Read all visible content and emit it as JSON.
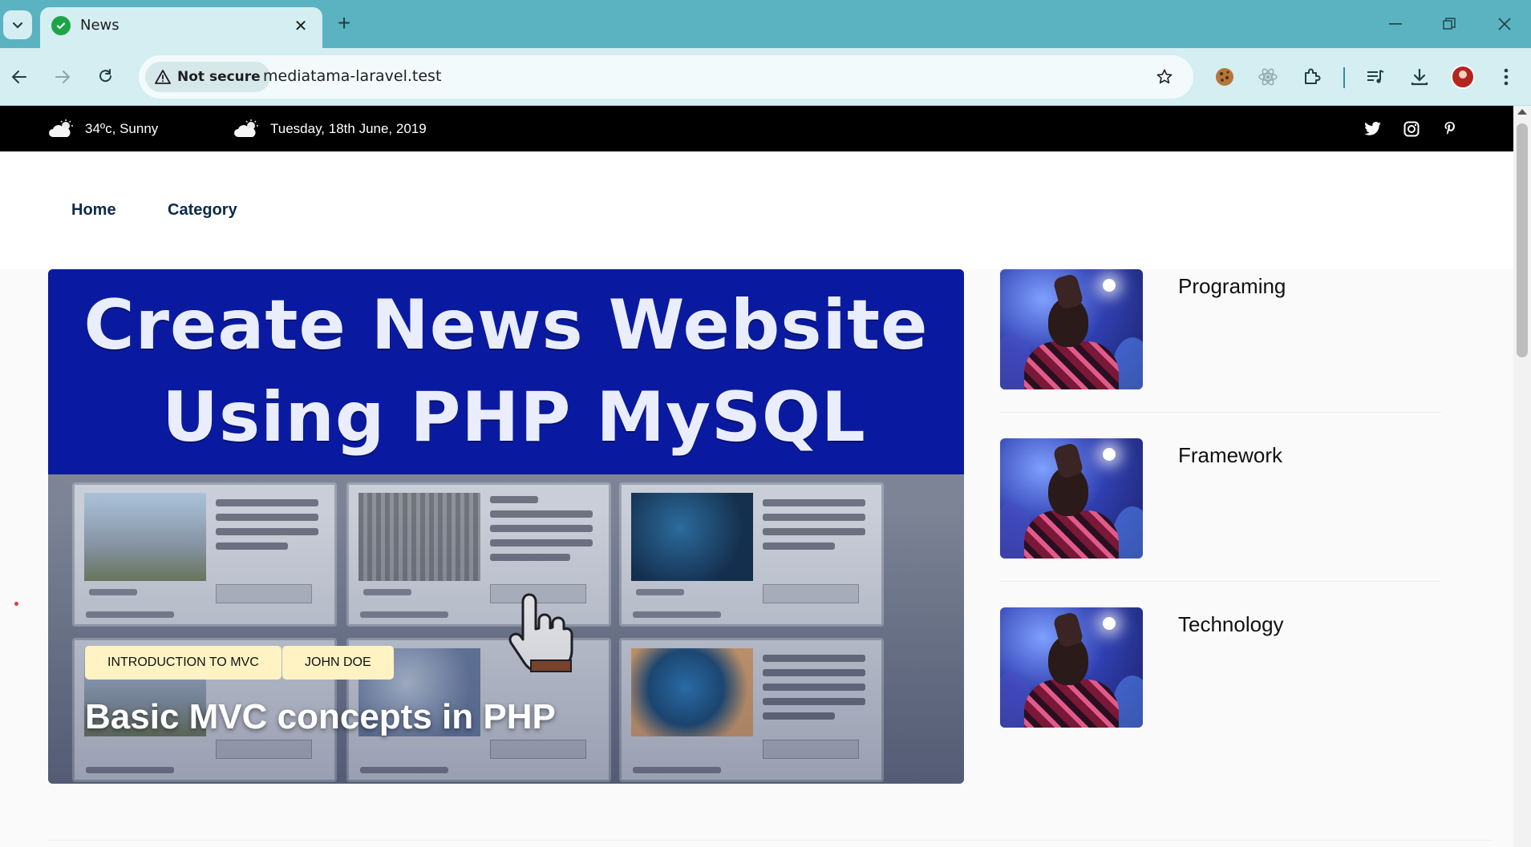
{
  "browser": {
    "tab_title": "News",
    "security_label": "Not secure",
    "url": "mediatama-laravel.test"
  },
  "topbar": {
    "weather_text": "34ºc, Sunny",
    "date_text": "Tuesday, 18th June, 2019",
    "social": [
      "twitter-icon",
      "instagram-icon",
      "pinterest-icon"
    ]
  },
  "nav": {
    "items": [
      "Home",
      "Category"
    ]
  },
  "hero": {
    "image_headline_line1": "Create News Website",
    "image_headline_line2": "Using PHP MySQL",
    "badges": [
      "INTRODUCTION TO MVC",
      "JOHN DOE"
    ],
    "title": "Basic MVC concepts in PHP"
  },
  "sidebar": {
    "items": [
      {
        "title": "Programing"
      },
      {
        "title": "Framework"
      },
      {
        "title": "Technology"
      }
    ]
  },
  "colors": {
    "tabstrip": "#5bb3c1",
    "toolbar": "#d4eef2",
    "topbar": "#000000",
    "nav_link": "#0b2a4a",
    "badge": "#fff3c4"
  }
}
